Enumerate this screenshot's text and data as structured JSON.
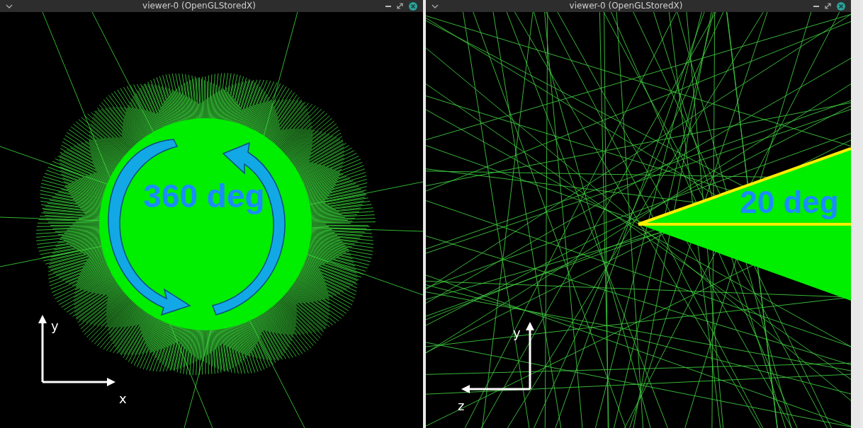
{
  "windows": [
    {
      "title": "viewer-0 (OpenGLStoredX)",
      "scene": {
        "kind": "burst"
      },
      "annotation": {
        "kind": "rotation",
        "label": "360 deg"
      },
      "axes": {
        "kind": "xy",
        "vertical": "y",
        "horizontal": "x"
      }
    },
    {
      "title": "viewer-0 (OpenGLStoredX)",
      "scene": {
        "kind": "tracks"
      },
      "annotation": {
        "kind": "wedge",
        "label": "20 deg"
      },
      "axes": {
        "kind": "zy",
        "vertical": "y",
        "horizontal": "z"
      }
    }
  ]
}
